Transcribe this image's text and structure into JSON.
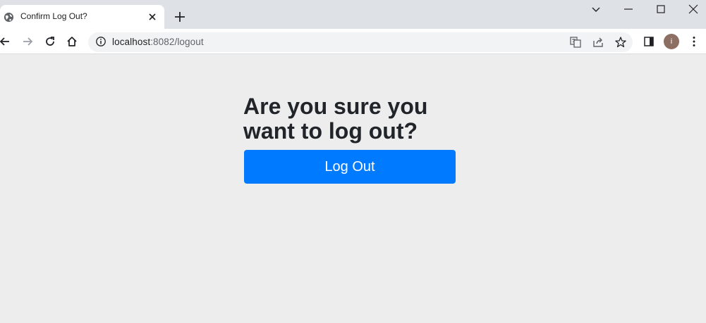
{
  "tab": {
    "title": "Confirm Log Out?"
  },
  "address_bar": {
    "host": "localhost",
    "path": ":8082/logout"
  },
  "profile": {
    "initial": "i",
    "color": "#8d6e63"
  },
  "page": {
    "heading": "Are you sure you want to log out?",
    "button_label": "Log Out",
    "accent_color": "#007bff"
  },
  "icons": [
    "globe-icon",
    "close-icon",
    "plus-icon",
    "chevron-down-icon",
    "minimize-icon",
    "maximize-icon",
    "window-close-icon",
    "back-arrow-icon",
    "forward-arrow-icon",
    "reload-icon",
    "home-icon",
    "info-icon",
    "translate-icon",
    "share-icon",
    "star-icon",
    "side-panel-icon",
    "kebab-menu-icon"
  ]
}
